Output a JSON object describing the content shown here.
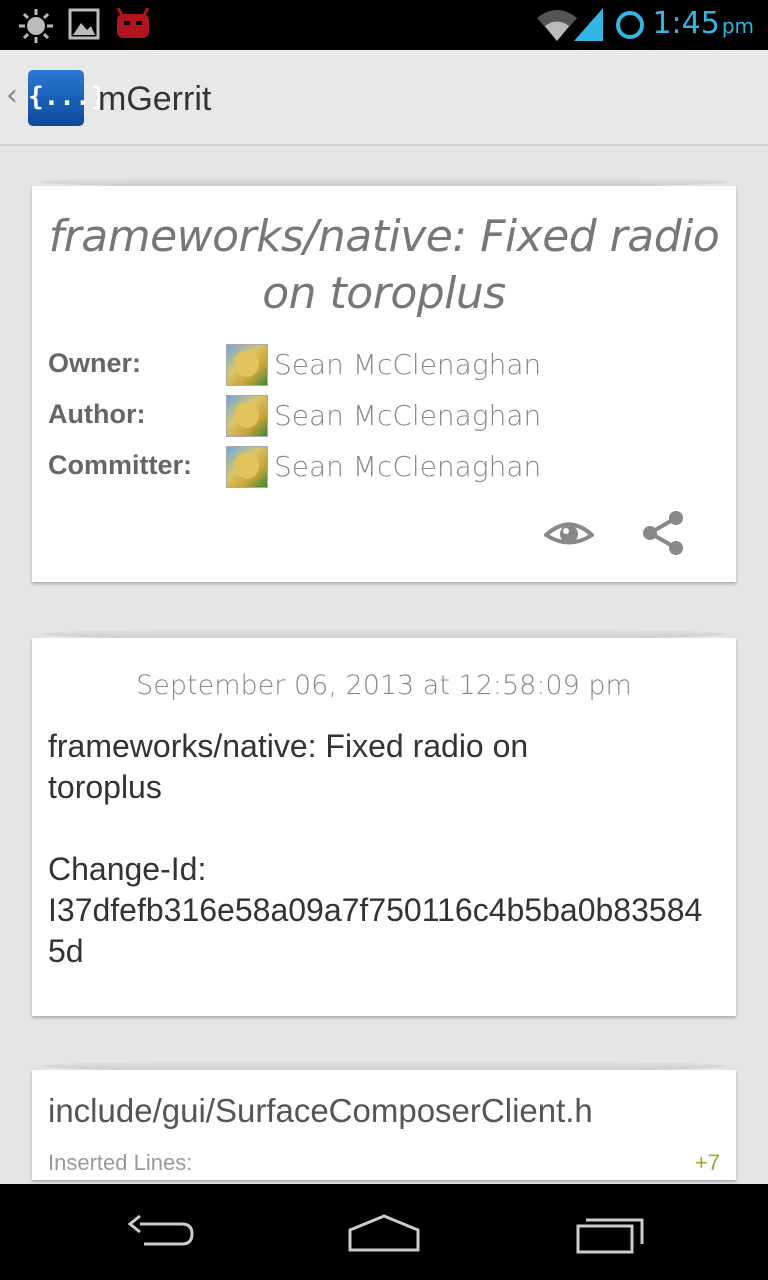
{
  "status_bar": {
    "time": "1:45",
    "ampm": "pm",
    "icons": [
      "brightness-icon",
      "gallery-icon",
      "cyanogenmod-icon",
      "wifi-icon",
      "signal-icon",
      "sync-icon"
    ]
  },
  "action_bar": {
    "logo_text": "{...}",
    "title": "mGerrit"
  },
  "change": {
    "subject": "frameworks/native: Fixed radio on toroplus",
    "people": [
      {
        "label": "Owner:",
        "name": "Sean McClenaghan"
      },
      {
        "label": "Author:",
        "name": "Sean McClenaghan"
      },
      {
        "label": "Committer:",
        "name": "Sean McClenaghan"
      }
    ],
    "actions": [
      "star-eye-icon",
      "share-icon"
    ]
  },
  "commit": {
    "date": "September 06, 2013 at 12:58:09 pm",
    "message": "frameworks/native: Fixed radio on\ntoroplus\n\nChange-Id:\nI37dfefb316e58a09a7f750116c4b5ba0b835845d"
  },
  "file": {
    "name": "include/gui/SurfaceComposerClient.h",
    "meta_label": "Inserted Lines:",
    "count": "+7"
  },
  "colors": {
    "accent": "#33b5e5",
    "insert_green": "#8bb530"
  }
}
